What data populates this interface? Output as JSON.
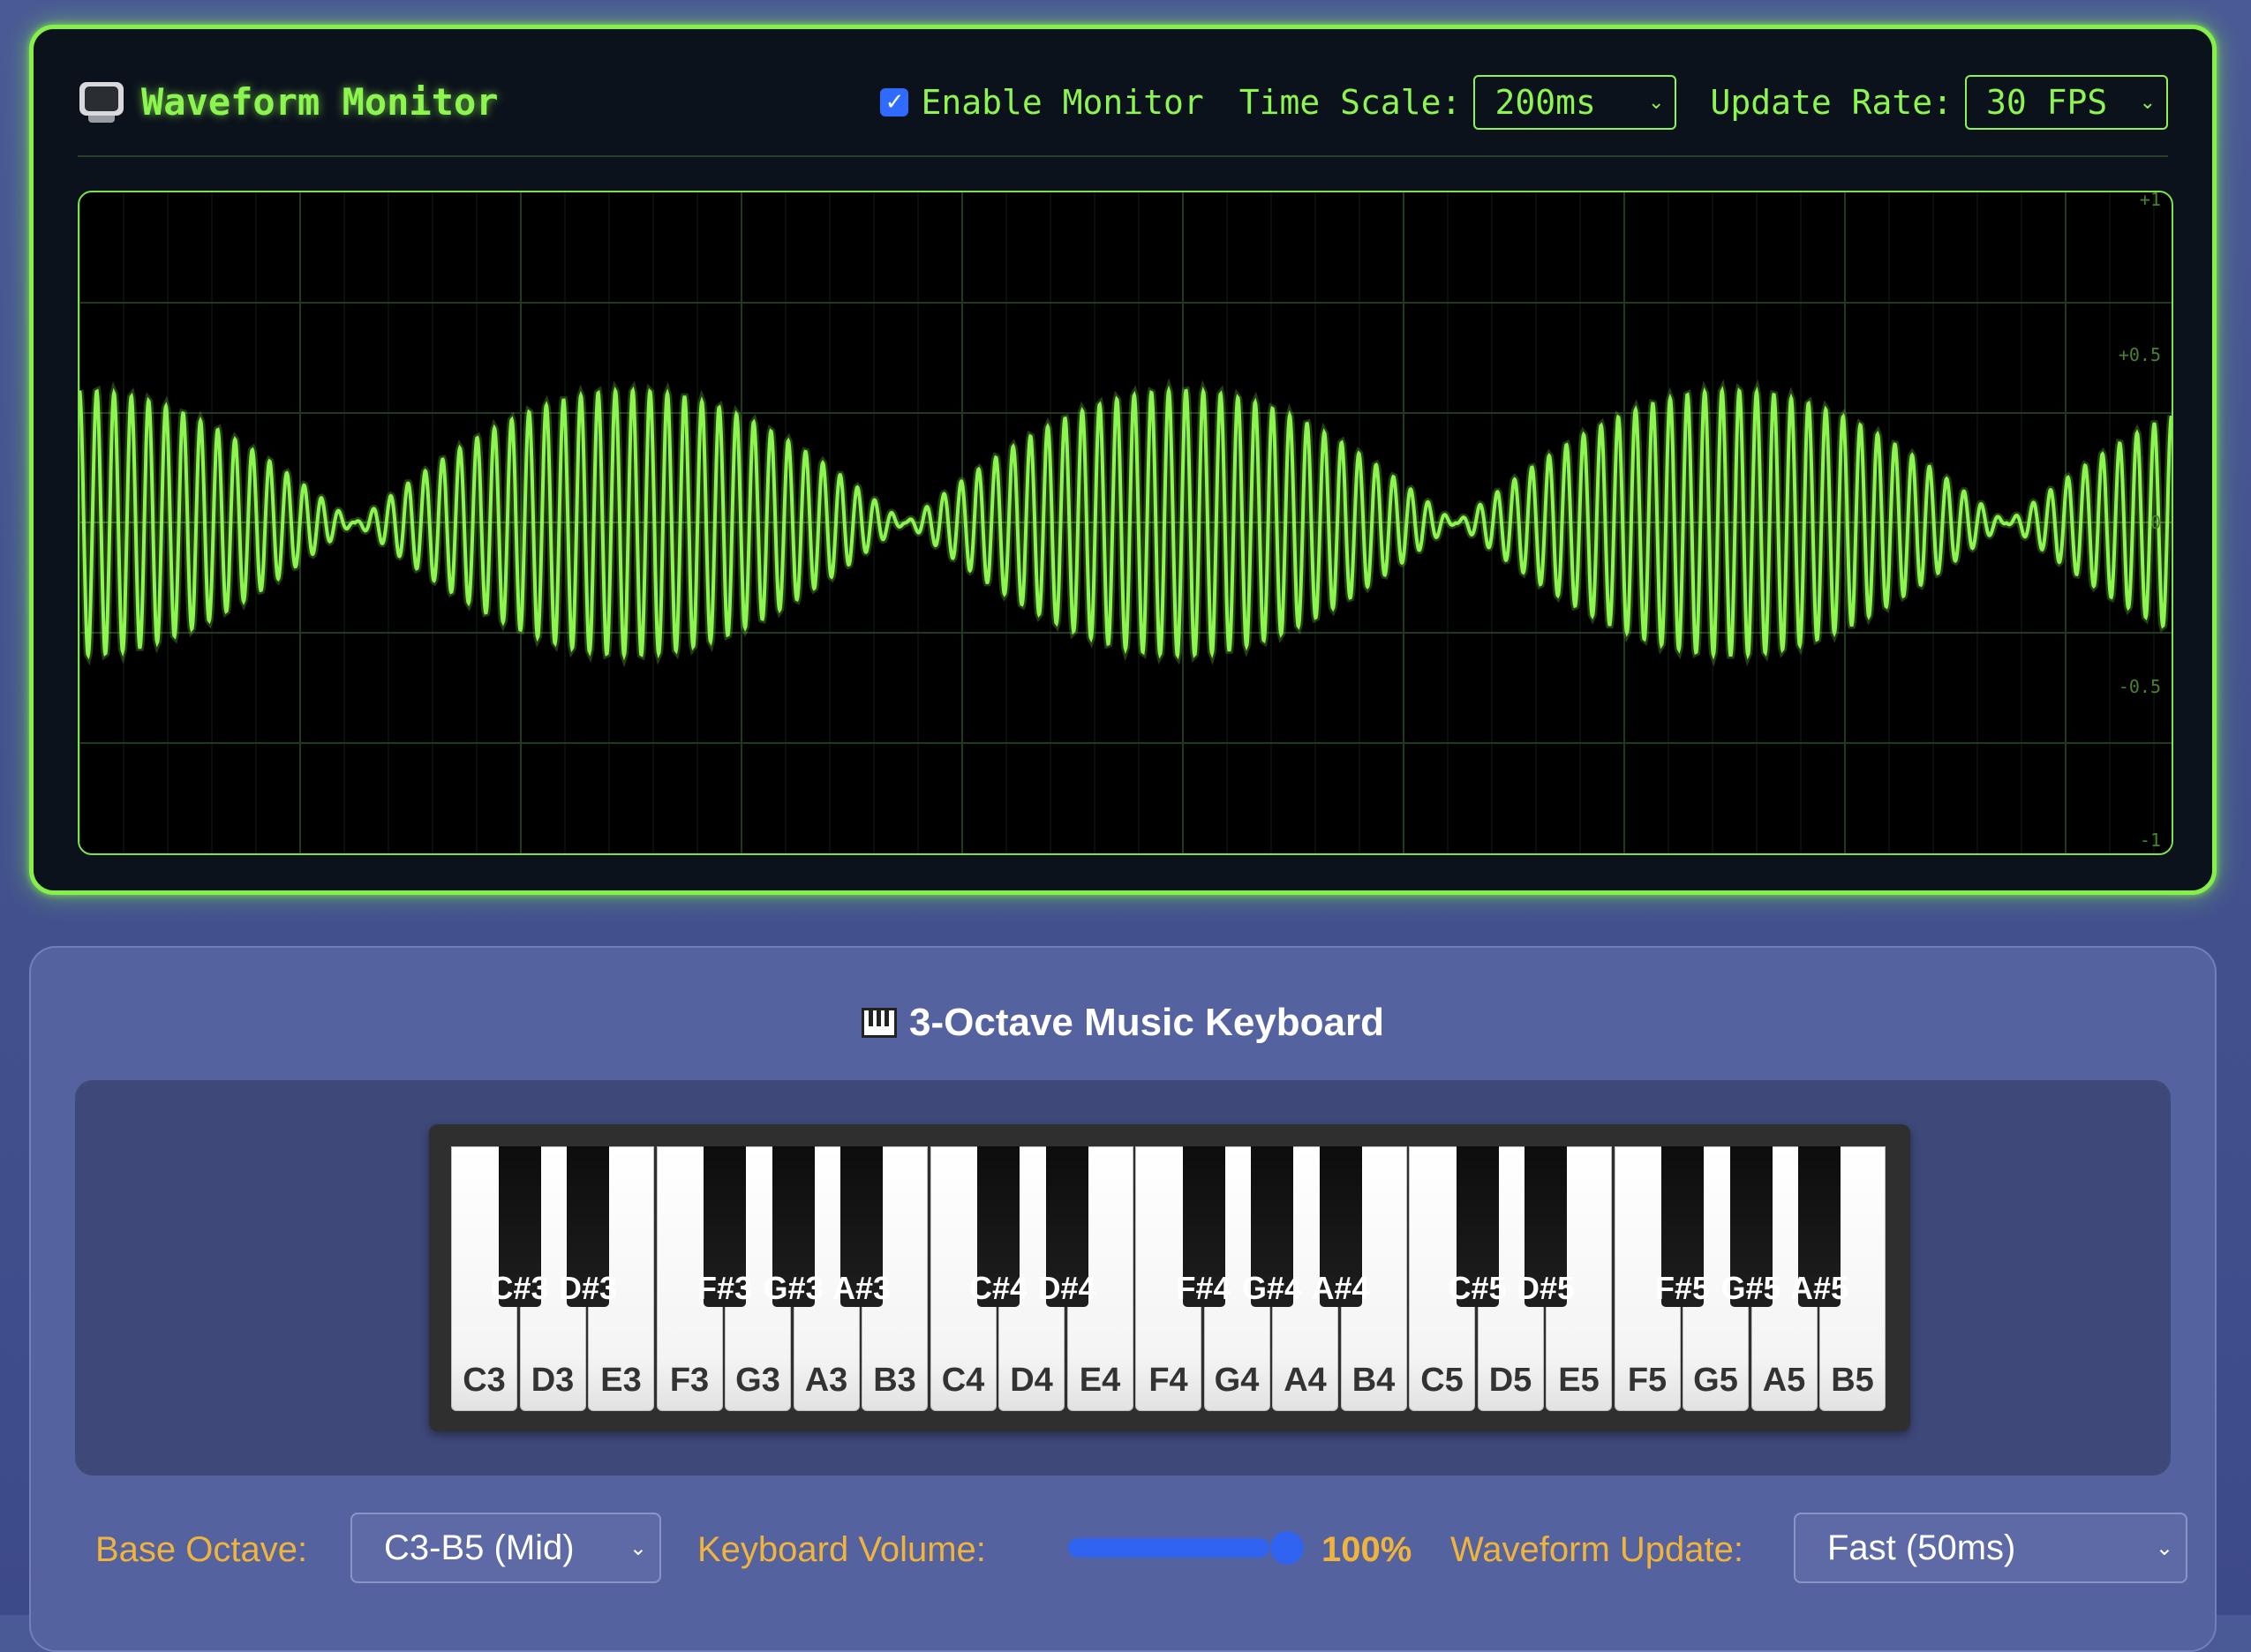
{
  "monitor": {
    "title": "Waveform Monitor",
    "icon": "tv-icon",
    "enable_label": "Enable Monitor",
    "enable_checked": true,
    "time_scale_label": "Time Scale:",
    "time_scale_value": "200ms",
    "update_rate_label": "Update Rate:",
    "update_rate_value": "30 FPS",
    "accent_color": "#86f04a",
    "scale_labels": {
      "top": "+1",
      "upper": "+0.5",
      "middle": "0",
      "lower": "-0.5",
      "bottom": "-1"
    }
  },
  "chart_data": {
    "type": "line",
    "title": "",
    "xlabel": "",
    "ylabel": "",
    "ylim": [
      -1,
      1
    ],
    "grid": true,
    "series": [
      {
        "amplitude_max": 0.4,
        "cycles": 121,
        "envelope_beats": 3.8,
        "color": "#8cf550"
      }
    ]
  },
  "keyboard": {
    "title": "3-Octave Music Keyboard",
    "icon": "piano-icon",
    "white_keys": [
      "C3",
      "D3",
      "E3",
      "F3",
      "G3",
      "A3",
      "B3",
      "C4",
      "D4",
      "E4",
      "F4",
      "G4",
      "A4",
      "B4",
      "C5",
      "D5",
      "E5",
      "F5",
      "G5",
      "A5",
      "B5"
    ],
    "black_keys": [
      {
        "label": "C#3",
        "after": 0
      },
      {
        "label": "D#3",
        "after": 1
      },
      {
        "label": "F#3",
        "after": 3
      },
      {
        "label": "G#3",
        "after": 4
      },
      {
        "label": "A#3",
        "after": 5
      },
      {
        "label": "C#4",
        "after": 7
      },
      {
        "label": "D#4",
        "after": 8
      },
      {
        "label": "F#4",
        "after": 10
      },
      {
        "label": "G#4",
        "after": 11
      },
      {
        "label": "A#4",
        "after": 12
      },
      {
        "label": "C#5",
        "after": 14
      },
      {
        "label": "D#5",
        "after": 15
      },
      {
        "label": "F#5",
        "after": 17
      },
      {
        "label": "G#5",
        "after": 18
      },
      {
        "label": "A#5",
        "after": 19
      }
    ],
    "base_octave_label": "Base Octave:",
    "base_octave_value": "C3-B5 (Mid)",
    "volume_label": "Keyboard Volume:",
    "volume_percent": 100,
    "volume_text": "100%",
    "waveform_update_label": "Waveform Update:",
    "waveform_update_value": "Fast (50ms)",
    "label_color": "#f0b43c"
  }
}
